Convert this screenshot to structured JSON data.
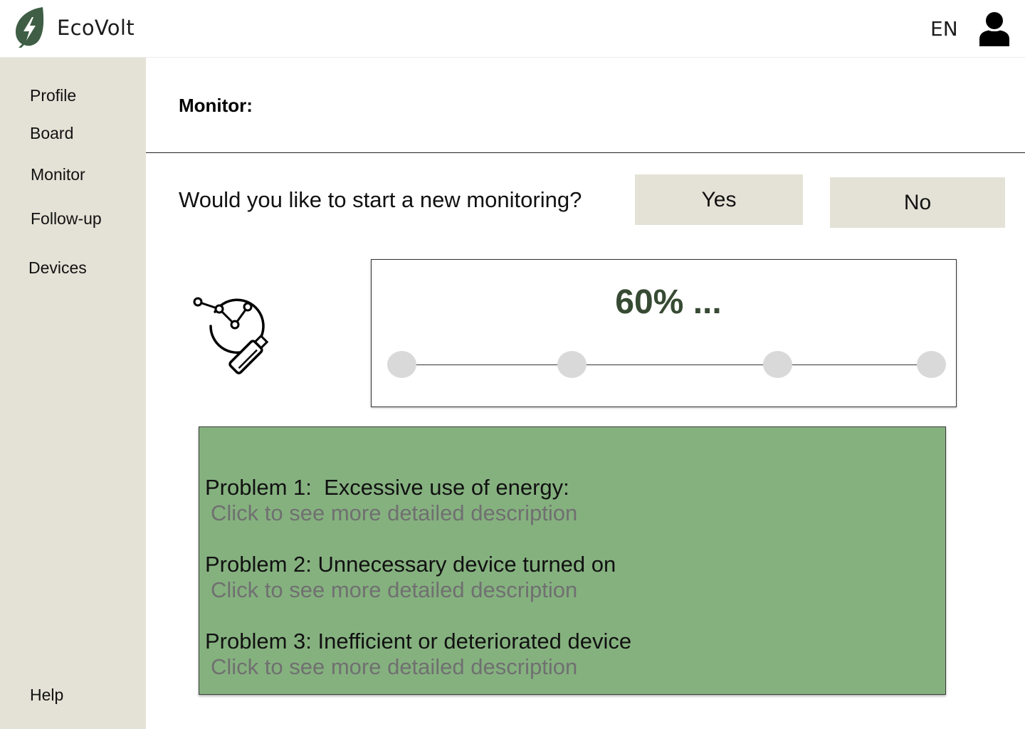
{
  "header": {
    "app_title": "EcoVolt",
    "language": "EN",
    "logo_icon": "leaf-lightning-icon",
    "user_icon": "user-icon"
  },
  "sidebar": {
    "items": [
      {
        "label": "Profile"
      },
      {
        "label": "Board"
      },
      {
        "label": "Monitor"
      },
      {
        "label": "Follow-up"
      },
      {
        "label": "Devices"
      }
    ],
    "help_label": "Help"
  },
  "main": {
    "section_title": "Monitor:",
    "question": "Would you like to start a new monitoring?",
    "yes_label": "Yes",
    "no_label": "No",
    "progress": {
      "text": "60% ...",
      "value": 0.6,
      "steps": 4
    },
    "problems": [
      {
        "title": "Problem 1:  Excessive use of energy:",
        "link": "Click to see more detailed description"
      },
      {
        "title": "Problem 2: Unnecessary device turned on",
        "link": "Click to see more detailed description"
      },
      {
        "title": "Problem 3: Inefficient or deteriorated device",
        "link": "Click to see more detailed description"
      }
    ]
  },
  "colors": {
    "sidebar_bg": "#e4e2d6",
    "button_bg": "#e4e2d6",
    "brand_green": "#3f5e45",
    "panel_green": "#85b17f",
    "progress_text": "#374a33",
    "link_gray": "#707070",
    "step_gray": "#d9d9d9"
  }
}
